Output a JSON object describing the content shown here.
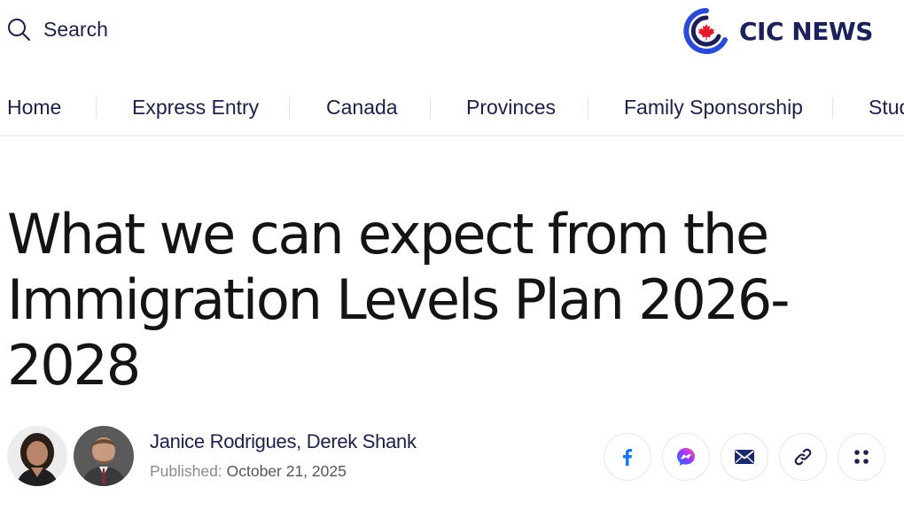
{
  "header": {
    "search_label": "Search",
    "logo_text": "CIC NEWS"
  },
  "nav": {
    "items": [
      {
        "label": "Home"
      },
      {
        "label": "Express Entry"
      },
      {
        "label": "Canada"
      },
      {
        "label": "Provinces"
      },
      {
        "label": "Family Sponsorship"
      },
      {
        "label": "Stud"
      }
    ]
  },
  "article": {
    "title": "What we can expect from the Immigration Levels Plan 2026-2028",
    "authors": "Janice Rodrigues, Derek Shank",
    "published_label": "Published:",
    "published_date": "October 21, 2025"
  },
  "share": {
    "buttons": [
      {
        "icon": "facebook-icon"
      },
      {
        "icon": "messenger-icon"
      },
      {
        "icon": "email-icon"
      },
      {
        "icon": "link-icon"
      },
      {
        "icon": "more-icon"
      }
    ]
  },
  "colors": {
    "brand_navy": "#1b1f5c",
    "brand_blue": "#2a4bd7",
    "maple_red": "#e11d2c",
    "facebook_blue": "#1877f2"
  }
}
